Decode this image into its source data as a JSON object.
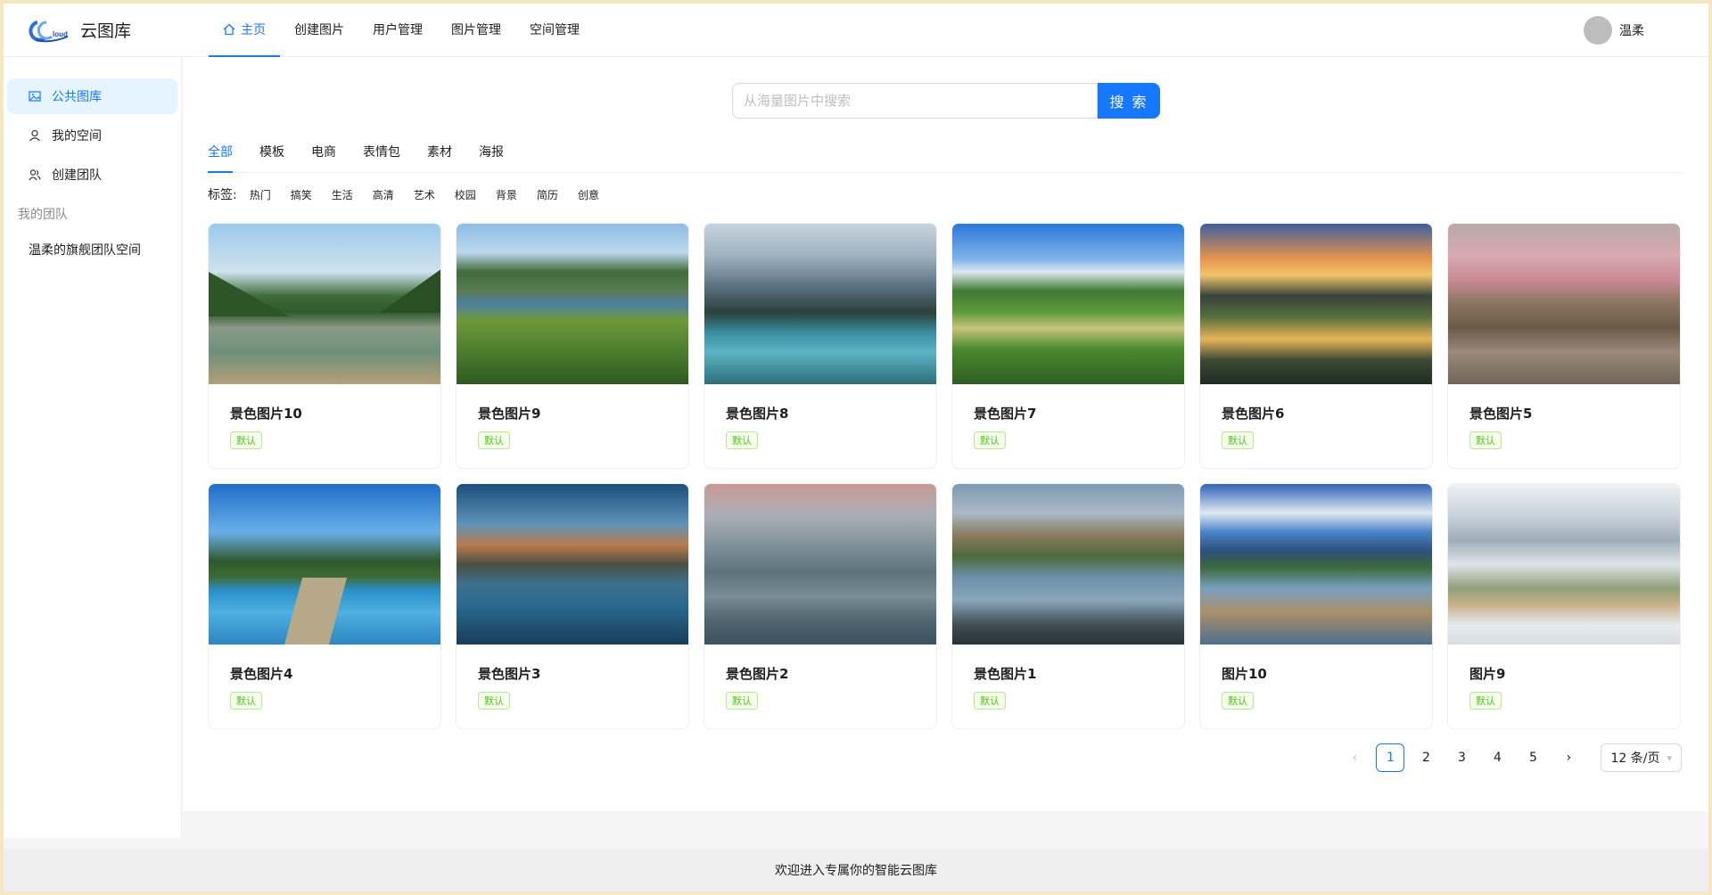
{
  "app": {
    "name": "云图库"
  },
  "nav": {
    "items": [
      "主页",
      "创建图片",
      "用户管理",
      "图片管理",
      "空间管理"
    ]
  },
  "user": {
    "name": "温柔"
  },
  "sidebar": {
    "items": [
      "公共图库",
      "我的空间",
      "创建团队"
    ],
    "group_label": "我的团队",
    "team_items": [
      "温柔的旗舰团队空间"
    ]
  },
  "search": {
    "placeholder": "从海量图片中搜索",
    "button": "搜 索"
  },
  "tabs": [
    "全部",
    "模板",
    "电商",
    "表情包",
    "素材",
    "海报"
  ],
  "tags": {
    "label": "标签:",
    "items": [
      "热门",
      "搞笑",
      "生活",
      "高清",
      "艺术",
      "校园",
      "背景",
      "简历",
      "创意"
    ]
  },
  "cards": [
    {
      "title": "景色图片10",
      "tag": "默认"
    },
    {
      "title": "景色图片9",
      "tag": "默认"
    },
    {
      "title": "景色图片8",
      "tag": "默认"
    },
    {
      "title": "景色图片7",
      "tag": "默认"
    },
    {
      "title": "景色图片6",
      "tag": "默认"
    },
    {
      "title": "景色图片5",
      "tag": "默认"
    },
    {
      "title": "景色图片4",
      "tag": "默认"
    },
    {
      "title": "景色图片3",
      "tag": "默认"
    },
    {
      "title": "景色图片2",
      "tag": "默认"
    },
    {
      "title": "景色图片1",
      "tag": "默认"
    },
    {
      "title": "图片10",
      "tag": "默认"
    },
    {
      "title": "图片9",
      "tag": "默认"
    }
  ],
  "pagination": {
    "prev": "‹",
    "pages": [
      "1",
      "2",
      "3",
      "4",
      "5"
    ],
    "next": "›",
    "current": "1",
    "page_size": "12 条/页"
  },
  "footer": {
    "text": "欢迎进入专属你的智能云图库"
  },
  "colors": {
    "accent": "#1677ff",
    "tag_green": "#52c41a"
  }
}
